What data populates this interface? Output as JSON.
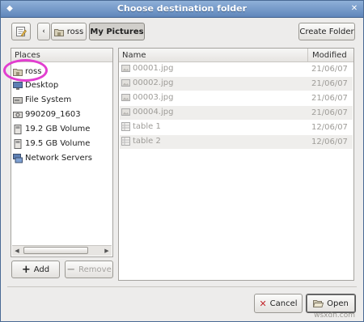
{
  "window": {
    "title": "Choose destination folder"
  },
  "toolbar": {
    "path_segments": [
      "ross",
      "My Pictures"
    ],
    "create_folder_label": "Create Folder"
  },
  "places": {
    "header": "Places",
    "items": [
      {
        "label": "ross",
        "icon": "home-folder-icon"
      },
      {
        "label": "Desktop",
        "icon": "desktop-icon"
      },
      {
        "label": "File System",
        "icon": "harddisk-icon"
      },
      {
        "label": "990209_1603",
        "icon": "optical-disc-icon"
      },
      {
        "label": "19.2 GB Volume",
        "icon": "drive-icon"
      },
      {
        "label": "19.5 GB Volume",
        "icon": "drive-icon"
      },
      {
        "label": "Network Servers",
        "icon": "network-icon"
      }
    ],
    "add_label": "Add",
    "remove_label": "Remove"
  },
  "files": {
    "columns": {
      "name": "Name",
      "modified": "Modified"
    },
    "rows": [
      {
        "name": "00001.jpg",
        "modified": "21/06/07",
        "icon": "image-file-icon"
      },
      {
        "name": "00002.jpg",
        "modified": "21/06/07",
        "icon": "image-file-icon"
      },
      {
        "name": "00003.jpg",
        "modified": "21/06/07",
        "icon": "image-file-icon"
      },
      {
        "name": "00004.jpg",
        "modified": "21/06/07",
        "icon": "image-file-icon"
      },
      {
        "name": "table 1",
        "modified": "12/06/07",
        "icon": "spreadsheet-file-icon"
      },
      {
        "name": "table 2",
        "modified": "12/06/07",
        "icon": "spreadsheet-file-icon"
      }
    ]
  },
  "footer": {
    "cancel_label": "Cancel",
    "open_label": "Open"
  },
  "watermark": "wsxdn.com"
}
